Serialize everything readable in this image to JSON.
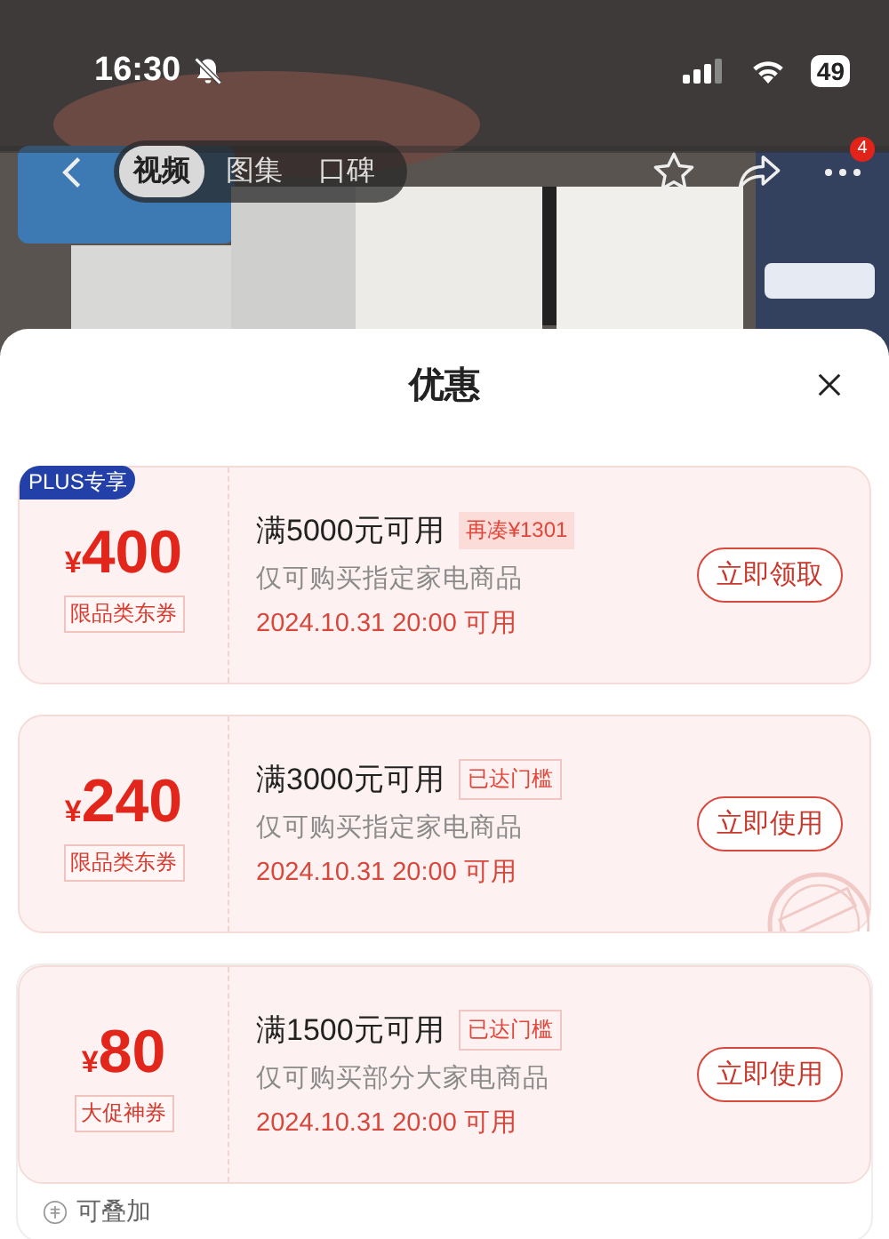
{
  "status_bar": {
    "time": "16:30",
    "battery": "49"
  },
  "nav": {
    "tabs": [
      {
        "label": "视频",
        "selected": true
      },
      {
        "label": "图集",
        "selected": false
      },
      {
        "label": "口碑",
        "selected": false
      }
    ],
    "more_badge": "4"
  },
  "sheet": {
    "title": "优惠",
    "coupons": [
      {
        "badge": "PLUS专享",
        "currency": "¥",
        "amount": "400",
        "type_tag": "限品类东券",
        "condition": "满5000元可用",
        "hint": "再凑¥1301",
        "kind": "shortfall",
        "scope": "仅可购买指定家电商品",
        "date": "2024.10.31 20:00 可用",
        "button": "立即领取",
        "claimed": false
      },
      {
        "currency": "¥",
        "amount": "240",
        "type_tag": "限品类东券",
        "condition": "满3000元可用",
        "hint": "已达门槛",
        "kind": "reached",
        "scope": "仅可购买指定家电商品",
        "date": "2024.10.31 20:00 可用",
        "button": "立即使用",
        "claimed": true
      },
      {
        "currency": "¥",
        "amount": "80",
        "type_tag": "大促神券",
        "condition": "满1500元可用",
        "hint": "已达门槛",
        "kind": "reached",
        "scope": "仅可购买部分大家电商品",
        "date": "2024.10.31 20:00 可用",
        "button": "立即使用",
        "claimed": false,
        "footer": "可叠加"
      }
    ]
  }
}
